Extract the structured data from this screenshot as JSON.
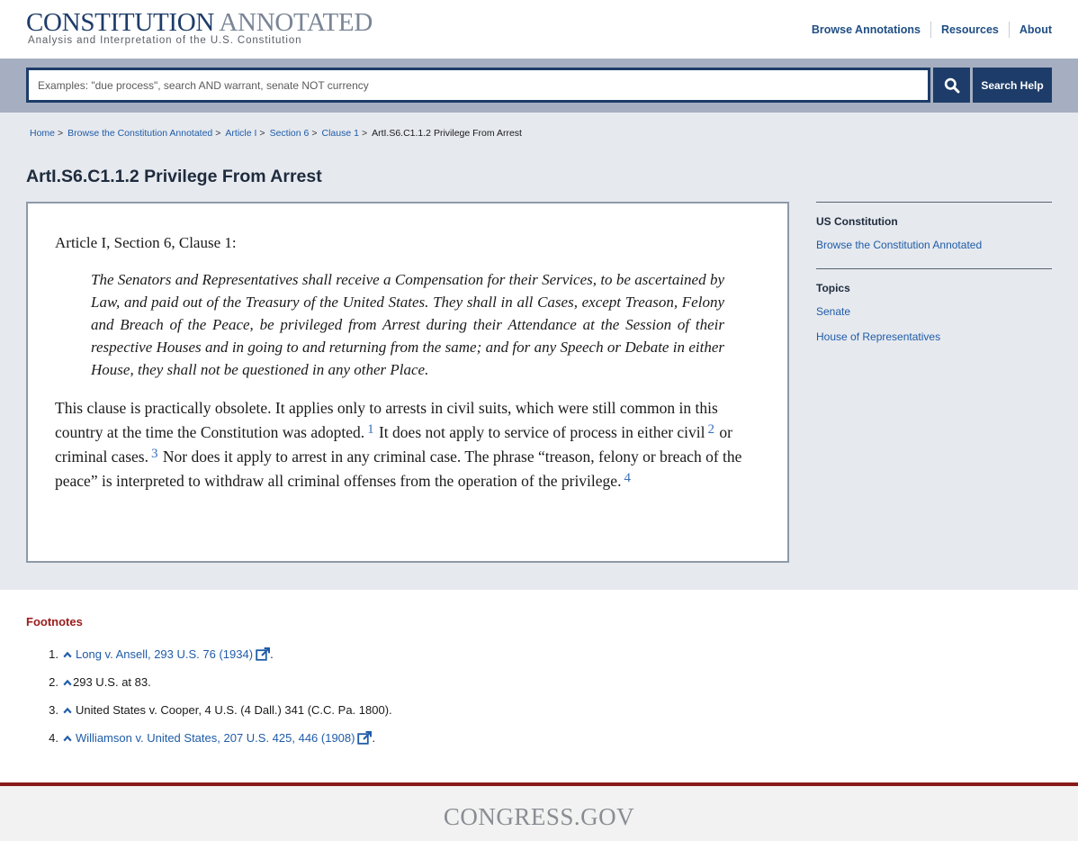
{
  "header": {
    "logo_title_word1": "CONSTITUTION",
    "logo_title_word2": "ANNOTATED",
    "logo_subtitle": "Analysis and Interpretation of the U.S. Constitution",
    "nav": [
      "Browse Annotations",
      "Resources",
      "About"
    ]
  },
  "search": {
    "placeholder": "Examples: \"due process\", search AND warrant, senate NOT currency",
    "value": "",
    "search_icon": "search-icon",
    "help_label": "Search Help"
  },
  "breadcrumb": {
    "items": [
      "Home",
      "Browse the Constitution Annotated",
      "Article I",
      "Section 6",
      "Clause 1"
    ],
    "separator": ">",
    "current": "ArtI.S6.C1.1.2 Privilege From Arrest"
  },
  "page": {
    "title": "ArtI.S6.C1.1.2 Privilege From Arrest"
  },
  "content": {
    "clause_heading": "Article I, Section 6, Clause 1:",
    "quote": "The Senators and Representatives shall receive a Compensation for their Services, to be ascertained by Law, and paid out of the Treasury of the United States. They shall in all Cases, except Treason, Felony and Breach of the Peace, be privileged from Arrest during their Attendance at the Session of their respective Houses and in going to and returning from the same; and for any Speech or Debate in either House, they shall not be questioned in any other Place.",
    "para_part1": "This clause is practically obsolete. It applies only to arrests in civil suits, which were still common in this country at the time the Constitution was adopted.",
    "fn1": "1",
    "para_part2": " It does not apply to service of process in either civil",
    "fn2": "2",
    "para_part3": " or criminal cases.",
    "fn3": "3",
    "para_part4": " Nor does it apply to arrest in any criminal case. The phrase “treason, felony or breach of the peace” is interpreted to withdraw all criminal offenses from the operation of the privilege.",
    "fn4": "4"
  },
  "sidebar": {
    "sections": [
      {
        "heading": "US Constitution",
        "links": [
          "Browse the Constitution Annotated"
        ]
      },
      {
        "heading": "Topics",
        "links": [
          "Senate",
          "House of Representatives"
        ]
      }
    ]
  },
  "footnotes": {
    "title": "Footnotes",
    "items": [
      {
        "num": "1.",
        "text": "Long v. Ansell, 293 U.S. 76 (1934)",
        "link": true,
        "suffix": "."
      },
      {
        "num": "2.",
        "text": "293 U.S. at 83.",
        "link": false,
        "suffix": ""
      },
      {
        "num": "3.",
        "text": "United States v. Cooper, 4 U.S. (4 Dall.) 341 (C.C. Pa. 1800).",
        "link": false,
        "suffix": ""
      },
      {
        "num": "4.",
        "text": "Williamson v. United States, 207 U.S. 425, 446 (1908)",
        "link": true,
        "suffix": "."
      }
    ]
  },
  "footer": {
    "logo": "CONGRESS.GOV"
  },
  "colors": {
    "navy": "#1d3c69",
    "link": "#1f5ca8",
    "footnote_title": "#9b1b1b",
    "footer_rule": "#8a1a1a"
  }
}
